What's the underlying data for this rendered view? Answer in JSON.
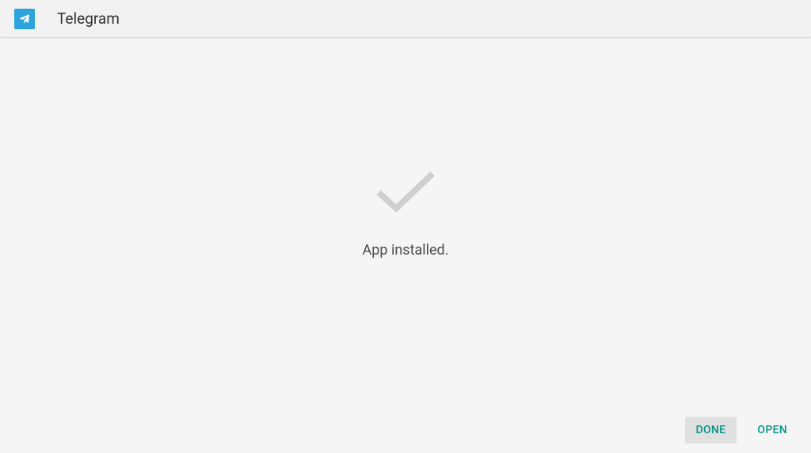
{
  "header": {
    "app_name": "Telegram",
    "icon_name": "telegram-icon"
  },
  "main": {
    "status_message": "App installed.",
    "check_icon": "checkmark-icon"
  },
  "actions": {
    "done_label": "DONE",
    "open_label": "OPEN"
  },
  "colors": {
    "brand": "#2ba3dd",
    "accent": "#009688",
    "check": "#cfcfcf"
  }
}
